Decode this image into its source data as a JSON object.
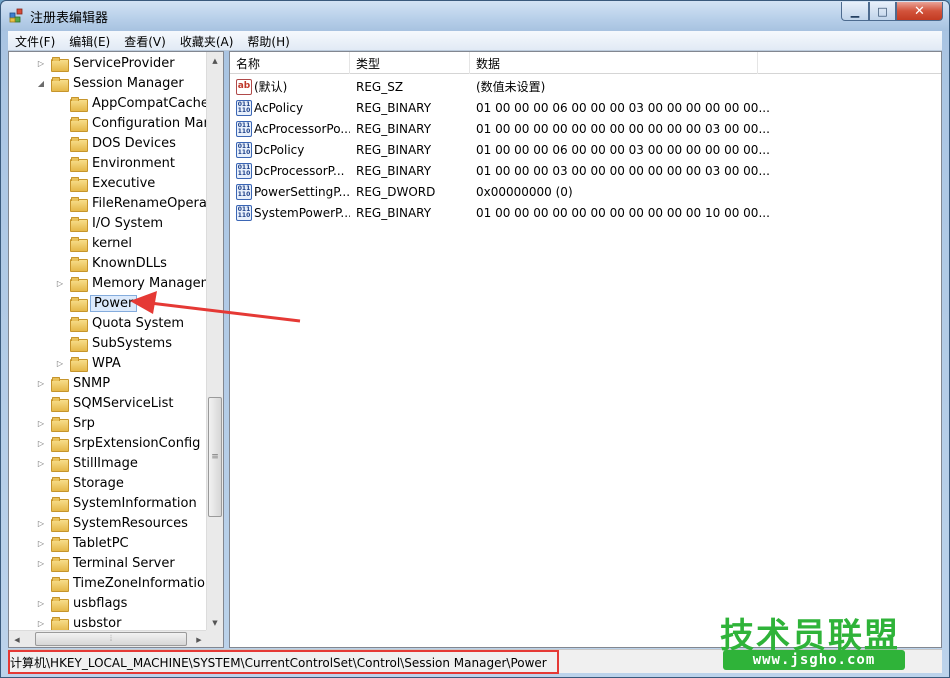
{
  "window": {
    "title": "注册表编辑器"
  },
  "menubar": {
    "items": [
      "文件(F)",
      "编辑(E)",
      "查看(V)",
      "收藏夹(A)",
      "帮助(H)"
    ]
  },
  "tree": {
    "items": [
      {
        "label": "ServiceProvider",
        "level": 1,
        "expander": "collapsed"
      },
      {
        "label": "Session Manager",
        "level": 1,
        "expander": "expanded"
      },
      {
        "label": "AppCompatCache",
        "level": 2,
        "expander": "none"
      },
      {
        "label": "Configuration Manag",
        "level": 2,
        "expander": "none"
      },
      {
        "label": "DOS Devices",
        "level": 2,
        "expander": "none"
      },
      {
        "label": "Environment",
        "level": 2,
        "expander": "none"
      },
      {
        "label": "Executive",
        "level": 2,
        "expander": "none"
      },
      {
        "label": "FileRenameOperatio",
        "level": 2,
        "expander": "none"
      },
      {
        "label": "I/O System",
        "level": 2,
        "expander": "none"
      },
      {
        "label": "kernel",
        "level": 2,
        "expander": "none"
      },
      {
        "label": "KnownDLLs",
        "level": 2,
        "expander": "none"
      },
      {
        "label": "Memory Manageme",
        "level": 2,
        "expander": "collapsed"
      },
      {
        "label": "Power",
        "level": 2,
        "expander": "none",
        "selected": true
      },
      {
        "label": "Quota System",
        "level": 2,
        "expander": "none"
      },
      {
        "label": "SubSystems",
        "level": 2,
        "expander": "none"
      },
      {
        "label": "WPA",
        "level": 2,
        "expander": "collapsed"
      },
      {
        "label": "SNMP",
        "level": 1,
        "expander": "collapsed"
      },
      {
        "label": "SQMServiceList",
        "level": 1,
        "expander": "none"
      },
      {
        "label": "Srp",
        "level": 1,
        "expander": "collapsed"
      },
      {
        "label": "SrpExtensionConfig",
        "level": 1,
        "expander": "collapsed"
      },
      {
        "label": "StillImage",
        "level": 1,
        "expander": "collapsed"
      },
      {
        "label": "Storage",
        "level": 1,
        "expander": "none"
      },
      {
        "label": "SystemInformation",
        "level": 1,
        "expander": "none"
      },
      {
        "label": "SystemResources",
        "level": 1,
        "expander": "collapsed"
      },
      {
        "label": "TabletPC",
        "level": 1,
        "expander": "collapsed"
      },
      {
        "label": "Terminal Server",
        "level": 1,
        "expander": "collapsed"
      },
      {
        "label": "TimeZoneInformation",
        "level": 1,
        "expander": "none"
      },
      {
        "label": "usbflags",
        "level": 1,
        "expander": "collapsed"
      },
      {
        "label": "usbstor",
        "level": 1,
        "expander": "collapsed"
      }
    ]
  },
  "list": {
    "columns": [
      "名称",
      "类型",
      "数据"
    ],
    "rows": [
      {
        "icon": "string-value-icon",
        "name": "(默认)",
        "type": "REG_SZ",
        "data": "(数值未设置)"
      },
      {
        "icon": "binary-value-icon",
        "name": "AcPolicy",
        "type": "REG_BINARY",
        "data": "01 00 00 00 06 00 00 00 03 00 00 00 00 00 00..."
      },
      {
        "icon": "binary-value-icon",
        "name": "AcProcessorPo...",
        "type": "REG_BINARY",
        "data": "01 00 00 00 00 00 00 00 00 00 00 00 03 00 00..."
      },
      {
        "icon": "binary-value-icon",
        "name": "DcPolicy",
        "type": "REG_BINARY",
        "data": "01 00 00 00 06 00 00 00 03 00 00 00 00 00 00..."
      },
      {
        "icon": "binary-value-icon",
        "name": "DcProcessorP...",
        "type": "REG_BINARY",
        "data": "01 00 00 00 03 00 00 00 00 00 00 00 03 00 00..."
      },
      {
        "icon": "binary-value-icon",
        "name": "PowerSettingP...",
        "type": "REG_DWORD",
        "data": "0x00000000 (0)"
      },
      {
        "icon": "binary-value-icon",
        "name": "SystemPowerP...",
        "type": "REG_BINARY",
        "data": "01 00 00 00 00 00 00 00 00 00 00 00 10 00 00..."
      }
    ]
  },
  "statusbar": {
    "path": "计算机\\HKEY_LOCAL_MACHINE\\SYSTEM\\CurrentControlSet\\Control\\Session Manager\\Power"
  },
  "watermark": {
    "brand": "技术员联盟",
    "url": "www.jsgho.com"
  },
  "colors": {
    "annotation": "#e53935",
    "watermark": "#2fb339",
    "selection": "#dceafc"
  }
}
